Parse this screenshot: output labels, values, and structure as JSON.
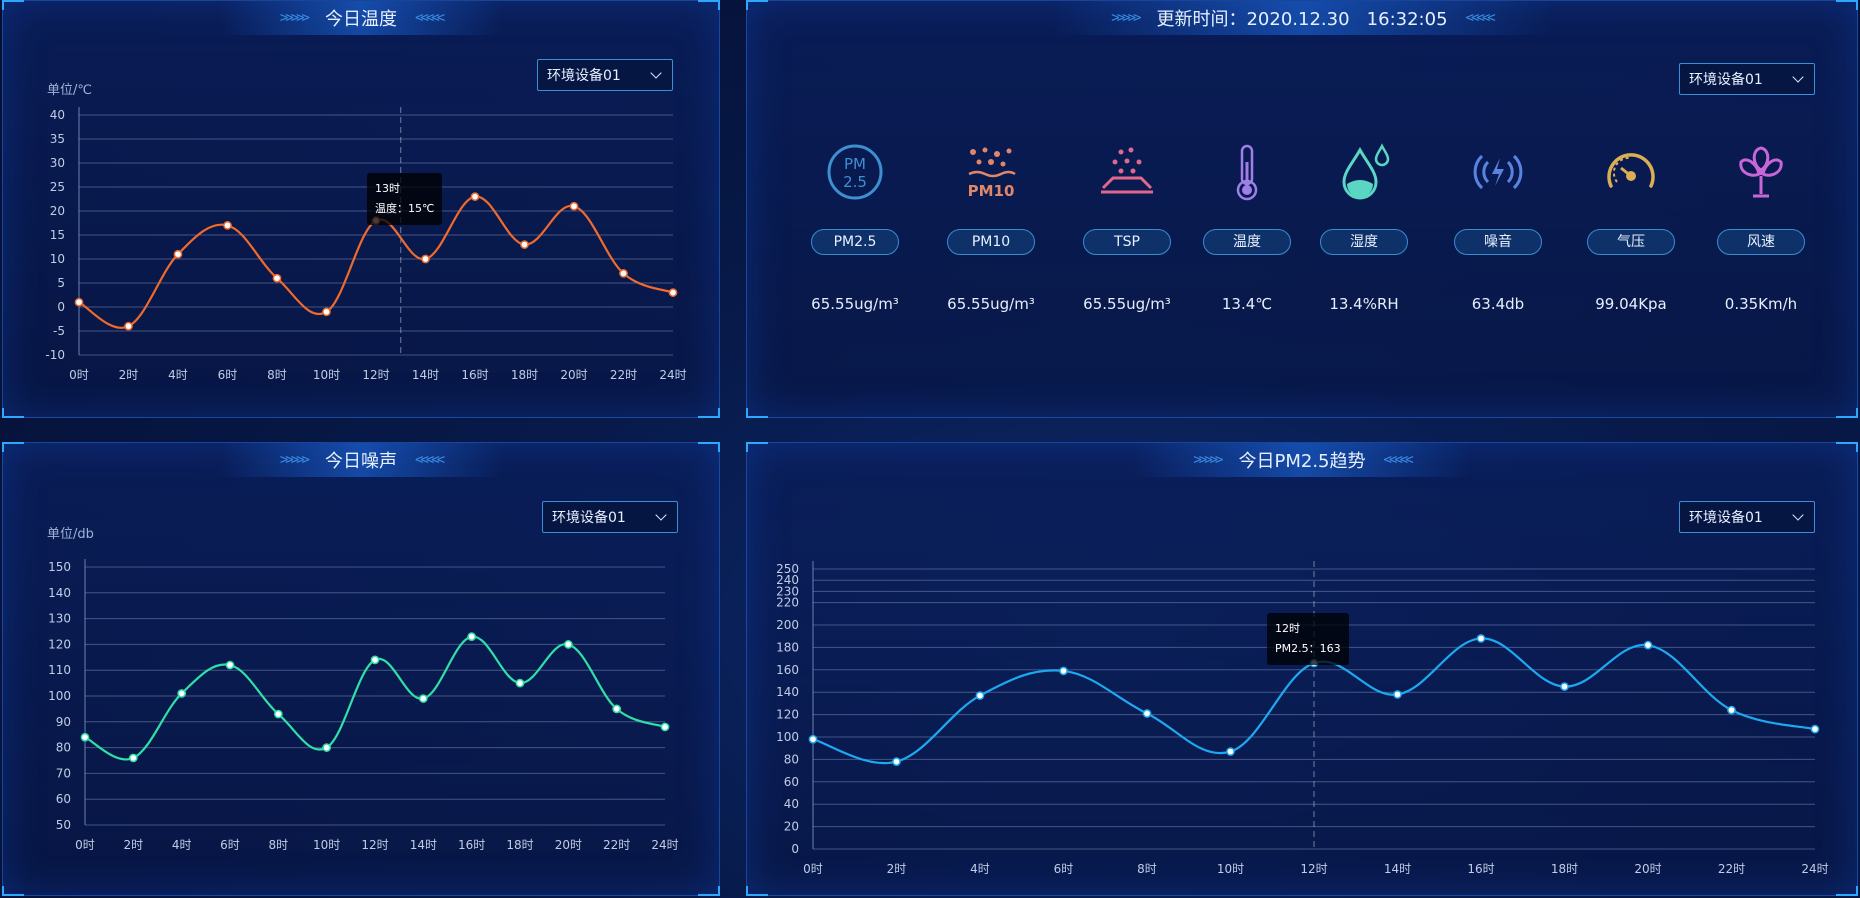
{
  "temp_panel": {
    "title": "今日温度",
    "select": "环境设备01",
    "unit": "单位/℃",
    "tooltip": {
      "label": "13时",
      "value": "温度：15℃"
    }
  },
  "status_panel": {
    "title": "更新时间：2020.12.30   16:32:05",
    "select": "环境设备01",
    "sensors": [
      {
        "label": "PM2.5",
        "value": "65.55ug/m³",
        "icon": "pm25-icon"
      },
      {
        "label": "PM10",
        "value": "65.55ug/m³",
        "icon": "pm10-icon"
      },
      {
        "label": "TSP",
        "value": "65.55ug/m³",
        "icon": "tsp-icon"
      },
      {
        "label": "温度",
        "value": "13.4℃",
        "icon": "thermometer-icon"
      },
      {
        "label": "湿度",
        "value": "13.4%RH",
        "icon": "humidity-icon"
      },
      {
        "label": "噪音",
        "value": "63.4db",
        "icon": "noise-icon"
      },
      {
        "label": "气压",
        "value": "99.04Kpa",
        "icon": "pressure-gauge-icon"
      },
      {
        "label": "风速",
        "value": "0.35Km/h",
        "icon": "fan-icon"
      }
    ]
  },
  "noise_panel": {
    "title": "今日噪声",
    "select": "环境设备01",
    "unit": "单位/db"
  },
  "pm_panel": {
    "title": "今日PM2.5趋势",
    "select": "环境设备01",
    "tooltip": {
      "label": "12时",
      "value": "PM2.5：163"
    }
  },
  "colors": {
    "temp": "#ef6a2c",
    "noise": "#2fe0a8",
    "pm": "#1ea8f0"
  },
  "chart_data": [
    {
      "type": "line",
      "title": "今日温度",
      "ylabel": "单位/℃",
      "x": [
        "0时",
        "2时",
        "4时",
        "6时",
        "8时",
        "10时",
        "12时",
        "14时",
        "16时",
        "18时",
        "20时",
        "22时",
        "24时"
      ],
      "series": [
        {
          "values": [
            1,
            -4,
            11,
            17,
            6,
            -1,
            18,
            10,
            23,
            13,
            21,
            7,
            3
          ]
        }
      ],
      "yticks": [
        -10,
        -5,
        0,
        5,
        10,
        15,
        20,
        25,
        30,
        35,
        40
      ],
      "ylim": [
        -10,
        40
      ],
      "grid": true
    },
    {
      "type": "line",
      "title": "今日噪声",
      "ylabel": "单位/db",
      "x": [
        "0时",
        "2时",
        "4时",
        "6时",
        "8时",
        "10时",
        "12时",
        "14时",
        "16时",
        "18时",
        "20时",
        "22时",
        "24时"
      ],
      "series": [
        {
          "values": [
            84,
            76,
            101,
            112,
            93,
            80,
            114,
            99,
            123,
            105,
            120,
            95,
            88
          ]
        }
      ],
      "yticks": [
        50,
        60,
        70,
        80,
        90,
        100,
        110,
        120,
        130,
        140,
        150
      ],
      "ylim": [
        50,
        150
      ],
      "grid": true
    },
    {
      "type": "line",
      "title": "今日PM2.5趋势",
      "x": [
        "0时",
        "2时",
        "4时",
        "6时",
        "8时",
        "10时",
        "12时",
        "14时",
        "16时",
        "18时",
        "20时",
        "22时",
        "24时"
      ],
      "series": [
        {
          "values": [
            98,
            78,
            137,
            159,
            121,
            87,
            166,
            138,
            188,
            145,
            182,
            124,
            107
          ]
        }
      ],
      "yticks": [
        0,
        20,
        40,
        60,
        80,
        100,
        120,
        140,
        160,
        180,
        200,
        220,
        230,
        240,
        250
      ],
      "ylim": [
        0,
        250
      ],
      "grid": true
    }
  ]
}
